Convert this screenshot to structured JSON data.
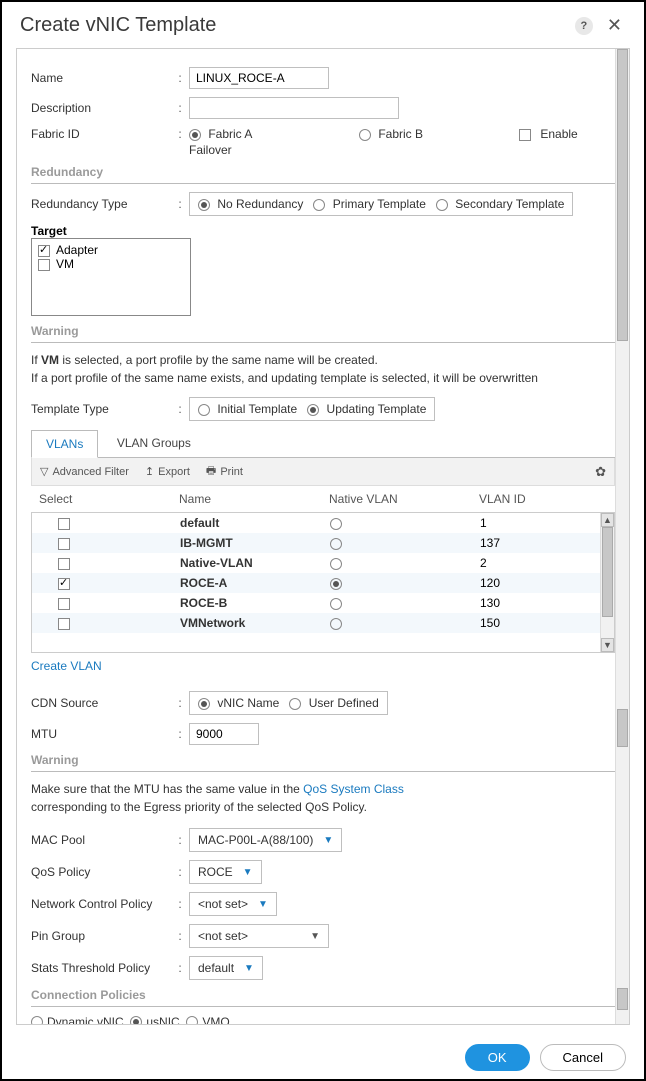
{
  "dialog": {
    "title": "Create vNIC Template",
    "ok": "OK",
    "cancel": "Cancel"
  },
  "fields": {
    "name_label": "Name",
    "name_value": "LINUX_ROCE-A",
    "description_label": "Description",
    "description_value": "",
    "fabric_id_label": "Fabric ID",
    "fabric_a": "Fabric A",
    "fabric_b": "Fabric B",
    "enable_failover": "Enable Failover",
    "redundancy_title": "Redundancy",
    "redundancy_type_label": "Redundancy Type",
    "redundancy_options": {
      "none": "No Redundancy",
      "primary": "Primary Template",
      "secondary": "Secondary Template"
    },
    "target_label": "Target",
    "target_adapter": "Adapter",
    "target_vm": "VM",
    "warning_title": "Warning",
    "warning_line1": "If VM is selected, a port profile by the same name will be created.",
    "warning_line2": "If a port profile of the same name exists, and updating template is selected, it will be overwritten",
    "warning_vm_bold": "VM",
    "template_type_label": "Template Type",
    "template_initial": "Initial Template",
    "template_updating": "Updating Template",
    "cdn_label": "CDN Source",
    "cdn_vnic": "vNIC Name",
    "cdn_user": "User Defined",
    "mtu_label": "MTU",
    "mtu_value": "9000",
    "mtu_warn1": "Make sure that the MTU has the same value in the ",
    "mtu_warn_link": "QoS System Class",
    "mtu_warn2": "corresponding to the Egress priority of the selected QoS Policy.",
    "mac_pool_label": "MAC Pool",
    "mac_pool_value": "MAC-P00L-A(88/100)",
    "qos_label": "QoS Policy",
    "qos_value": "ROCE",
    "net_ctrl_label": "Network Control Policy",
    "net_ctrl_value": "<not set>",
    "pin_label": "Pin Group",
    "pin_value": "<not set>",
    "stats_label": "Stats Threshold Policy",
    "stats_value": "default",
    "conn_title": "Connection Policies",
    "conn_dynamic": "Dynamic vNIC",
    "conn_usnic": "usNIC",
    "conn_vmq": "VMQ"
  },
  "tabs": {
    "vlans": "VLANs",
    "groups": "VLAN Groups"
  },
  "toolbar": {
    "filter": "Advanced Filter",
    "export": "Export",
    "print": "Print"
  },
  "table": {
    "headers": {
      "select": "Select",
      "name": "Name",
      "native": "Native VLAN",
      "id": "VLAN ID"
    },
    "rows": [
      {
        "selected": false,
        "name": "default",
        "native": false,
        "id": "1"
      },
      {
        "selected": false,
        "name": "IB-MGMT",
        "native": false,
        "id": "137"
      },
      {
        "selected": false,
        "name": "Native-VLAN",
        "native": false,
        "id": "2"
      },
      {
        "selected": true,
        "name": "ROCE-A",
        "native": true,
        "id": "120"
      },
      {
        "selected": false,
        "name": "ROCE-B",
        "native": false,
        "id": "130"
      },
      {
        "selected": false,
        "name": "VMNetwork",
        "native": false,
        "id": "150"
      }
    ],
    "create_link": "Create VLAN"
  }
}
